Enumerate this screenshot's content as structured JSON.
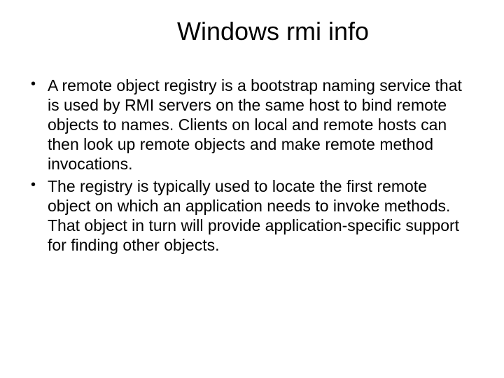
{
  "slide": {
    "title": "Windows rmi info",
    "bullets": [
      "A remote object registry is a bootstrap naming service that is used by RMI servers on the same host to bind remote objects to names. Clients on local and remote hosts can then look up remote objects and make remote method invocations.",
      "The registry is typically used to locate the first remote object on which an application needs to invoke methods. That object in turn will provide application-specific support for finding other objects."
    ]
  }
}
